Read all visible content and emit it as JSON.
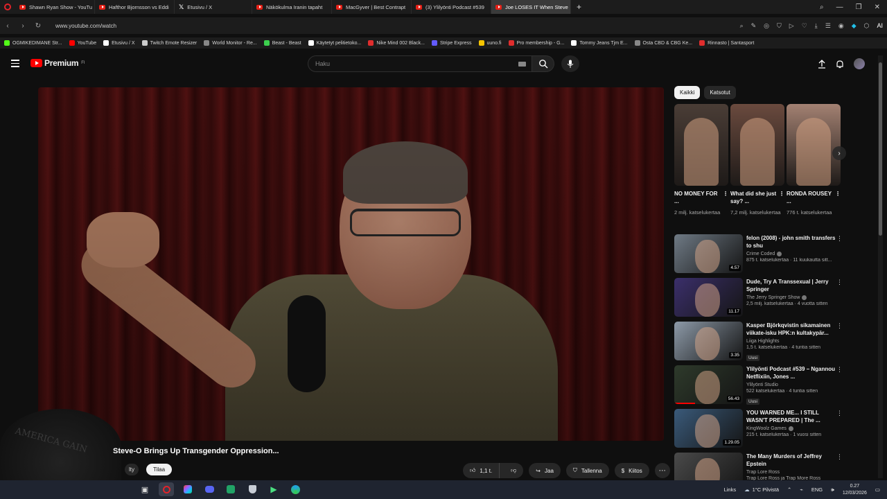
{
  "browser": {
    "tabs": [
      {
        "label": "Shawn Ryan Show - YouTu",
        "icon": "youtube",
        "active": false
      },
      {
        "label": "Hafthor Bjornsson vs Eddi",
        "icon": "youtube",
        "active": false
      },
      {
        "label": "Etusivu / X",
        "icon": "x",
        "active": false
      },
      {
        "label": "Näkökulma Iranin tapaht",
        "icon": "youtube",
        "active": false
      },
      {
        "label": "MacGyver | Best Contrapt",
        "icon": "youtube",
        "active": false
      },
      {
        "label": "(3) Ylilyönti Podcast #539",
        "icon": "youtube",
        "active": false
      },
      {
        "label": "Joe LOSES IT When Steve",
        "icon": "youtube",
        "active": true
      }
    ],
    "new_tab": "+",
    "url": "www.youtube.com/watch",
    "ai_label": "AI",
    "bookmarks": [
      {
        "label": "OGMIKEDIMANE Str...",
        "color": "#53fc18"
      },
      {
        "label": "YouTube",
        "color": "#ff0000"
      },
      {
        "label": "Etusivu / X",
        "color": "#ffffff"
      },
      {
        "label": "Twitch Emote Resizer",
        "color": "#cccccc"
      },
      {
        "label": "World Monitor - Re...",
        "color": "#888888"
      },
      {
        "label": "Beast - Beast",
        "color": "#3ccf4e"
      },
      {
        "label": "Käytetyt pelitietoko...",
        "color": "#ffffff"
      },
      {
        "label": "Nike Mind 002 Black...",
        "color": "#e02d2d"
      },
      {
        "label": "Stripe Express",
        "color": "#635bff"
      },
      {
        "label": "uuno.fi",
        "color": "#f5c400"
      },
      {
        "label": "Pro membership - G...",
        "color": "#e02d2d"
      },
      {
        "label": "Tommy Jeans Tjm E...",
        "color": "#ffffff"
      },
      {
        "label": "Osta CBD & CBG Ke...",
        "color": "#888888"
      },
      {
        "label": "Rinnasto | Santasport",
        "color": "#e02d2d"
      }
    ]
  },
  "youtube": {
    "logo_text": "Premium",
    "logo_badge": "FI",
    "search_placeholder": "Haku",
    "video": {
      "title": "Steve-O Brings Up Transgender Oppression...",
      "channel_fragment": "lty",
      "subscribe_label": "Tilaa",
      "likes": "1,1 t.",
      "share_label": "Jaa",
      "save_label": "Tallenna",
      "thanks_label": "Kiitos",
      "hat_text": "AMERICA GAIN"
    },
    "filter_chips": [
      {
        "label": "Kaikki",
        "selected": true
      },
      {
        "label": "Katsotut",
        "selected": false
      }
    ],
    "shorts": [
      {
        "title": "NO MONEY FOR ...",
        "views": "2 milj. katselukertaa",
        "bg": "#4a3d36"
      },
      {
        "title": "What did she just say? ...",
        "views": "7,2 milj. katselukertaa",
        "bg": "#6a4a3e"
      },
      {
        "title": "RONDA ROUSEY ...",
        "views": "776 t. katselukertaa",
        "bg": "#a38172"
      }
    ],
    "recommended": [
      {
        "title": "felon (2008) - john smith transfers to shu",
        "channel": "Crime Coded",
        "verified": true,
        "meta": "875 t. katselukertaa · 11 kuukautta sitt...",
        "duration": "4.57",
        "badge": "",
        "bg": "#6f7a85",
        "progress": 0
      },
      {
        "title": "Dude, Try A Transsexual | Jerry Springer",
        "channel": "The Jerry Springer Show",
        "verified": true,
        "meta": "2,5 milj. katselukertaa · 4 vuotta sitten",
        "duration": "11.17",
        "badge": "",
        "bg": "#3b2f6b",
        "progress": 0
      },
      {
        "title": "Kasper Björkqvistin sikamainen viikate-isku HPK:n kultakypär...",
        "channel": "Liiga Highlights",
        "verified": false,
        "meta": "1,5 t. katselukertaa · 4 tuntia sitten",
        "duration": "3.35",
        "badge": "Uusi",
        "bg": "#8d9aa8",
        "progress": 0
      },
      {
        "title": "Ylilyönti Podcast #539 – Ngannou Netflixiin, Jones ...",
        "channel": "Ylilyönti Studio",
        "verified": false,
        "meta": "522 katselukertaa · 4 tuntia sitten",
        "duration": "56.43",
        "badge": "Uusi",
        "bg": "#2e3a2b",
        "progress": 0.3
      },
      {
        "title": "YOU WARNED ME... I STILL WASN'T PREPARED | The ...",
        "channel": "KingWoolz Games",
        "verified": true,
        "meta": "215 t. katselukertaa · 1 vuosi sitten",
        "duration": "1.29.05",
        "badge": "",
        "bg": "#3a5a7a",
        "progress": 0
      },
      {
        "title": "The Many Murders of Jeffrey Epstein",
        "channel": "Trap Lore Ross",
        "verified": false,
        "meta": "Trap Lore Ross ja Trap More Ross",
        "duration": "",
        "badge": "",
        "bg": "#4a4a4a",
        "progress": 0
      }
    ]
  },
  "taskbar": {
    "links_label": "Links",
    "weather": "1°C  Pilvistä",
    "lang": "ENG",
    "time": "0.27",
    "date": "12/03/2026"
  }
}
